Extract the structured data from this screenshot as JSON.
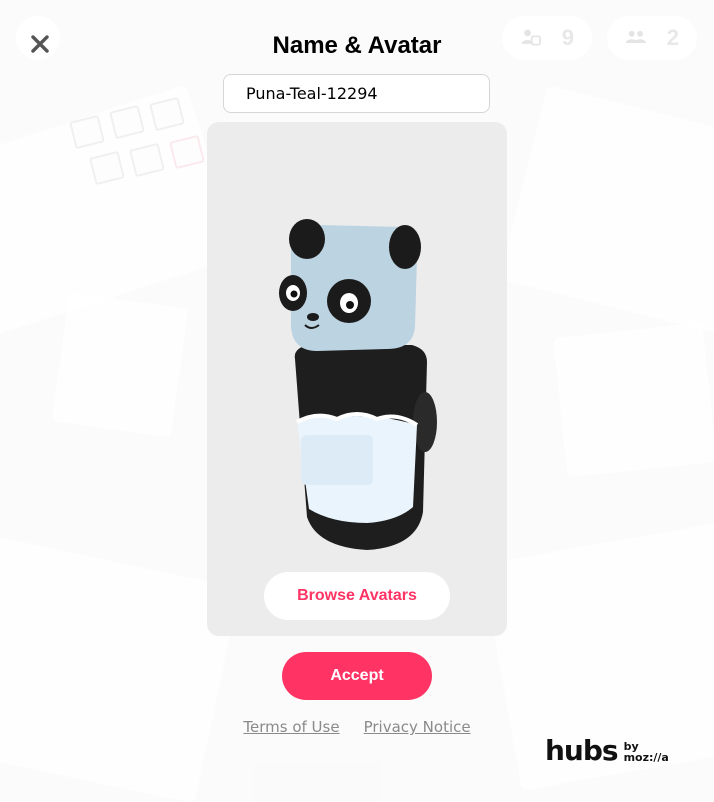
{
  "header": {
    "title": "Name & Avatar",
    "close_icon": "close-icon"
  },
  "presence": {
    "room_count": "9",
    "room_icon": "room-people-icon",
    "users_count": "2",
    "users_icon": "users-icon"
  },
  "profile": {
    "display_name": "Puna-Teal-12294"
  },
  "avatar_preview": {
    "avatar_description_icon": "panda-avatar",
    "browse_label": "Browse Avatars"
  },
  "actions": {
    "accept_label": "Accept"
  },
  "footer": {
    "terms_label": "Terms of Use",
    "privacy_label": "Privacy Notice",
    "brand_word": "hubs",
    "brand_by": "by",
    "brand_org": "moz://a"
  },
  "colors": {
    "accent": "#ff3464",
    "link": "#8a8a8a"
  }
}
